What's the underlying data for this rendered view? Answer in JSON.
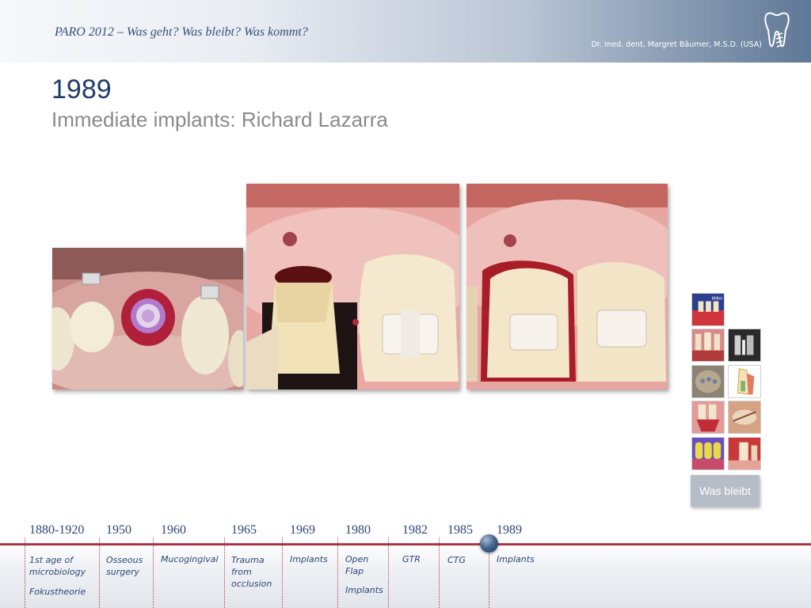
{
  "header": {
    "title": "PARO 2012 – Was geht? Was bleibt? Was kommt?",
    "author": "Dr. med. dent. Margret Bäumer, M.S.D. (USA)",
    "logo_icon": "tooth-logo-icon"
  },
  "slide": {
    "year": "1989",
    "subtitle": "Immediate implants: Richard Lazarra"
  },
  "photos": [
    {
      "name": "occlusal-view-implant-photo"
    },
    {
      "name": "abutment-in-place-photo"
    },
    {
      "name": "provisional-crown-photo"
    }
  ],
  "thumbnails": [
    {
      "name": "thumbnail-1",
      "label": "Miller"
    },
    {
      "name": "thumbnail-2"
    },
    {
      "name": "thumbnail-3"
    },
    {
      "name": "thumbnail-4"
    },
    {
      "name": "thumbnail-5"
    },
    {
      "name": "thumbnail-6"
    },
    {
      "name": "thumbnail-7"
    },
    {
      "name": "thumbnail-8"
    },
    {
      "name": "thumbnail-9"
    }
  ],
  "was_bleibt_button": "Was bleibt",
  "timeline": {
    "active_year": "1989",
    "items": [
      {
        "year": "1880-1920",
        "events": [
          "1st age of microbiology",
          "Fokustheorie"
        ]
      },
      {
        "year": "1950",
        "events": [
          "Osseous surgery"
        ]
      },
      {
        "year": "1960",
        "events": [
          "Mucogingival"
        ]
      },
      {
        "year": "1965",
        "events": [
          "Trauma from occlusion"
        ]
      },
      {
        "year": "1969",
        "events": [
          "Implants"
        ]
      },
      {
        "year": "1980",
        "events": [
          "Open Flap",
          "Implants"
        ]
      },
      {
        "year": "1982",
        "events": [
          "GTR"
        ]
      },
      {
        "year": "1985",
        "events": [
          "CTG"
        ]
      },
      {
        "year": "1989",
        "events": [
          "Implants"
        ]
      }
    ]
  },
  "colors": {
    "title_blue": "#1f3d6b",
    "subtitle_gray": "#8a8a8a",
    "timeline_red": "#9a2233",
    "timeline_text": "#2c4678"
  }
}
